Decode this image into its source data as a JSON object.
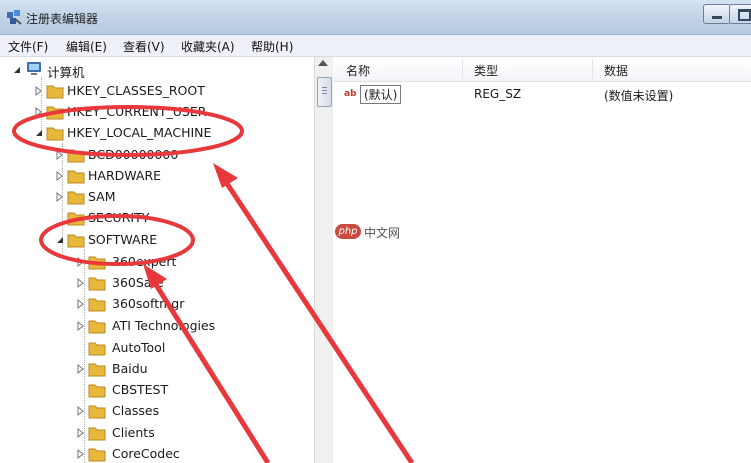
{
  "window": {
    "title": "注册表编辑器"
  },
  "menu": [
    {
      "label": "文件(F)"
    },
    {
      "label": "编辑(E)"
    },
    {
      "label": "查看(V)"
    },
    {
      "label": "收藏夹(A)"
    },
    {
      "label": "帮助(H)"
    }
  ],
  "tree": {
    "root": "计算机",
    "hives": [
      {
        "label": "HKEY_CLASSES_ROOT"
      },
      {
        "label": "HKEY_CURRENT_USER"
      },
      {
        "label": "HKEY_LOCAL_MACHINE"
      }
    ],
    "hklm_children": [
      {
        "label": "BCD00000000"
      },
      {
        "label": "HARDWARE"
      },
      {
        "label": "SAM"
      },
      {
        "label": "SECURITY"
      },
      {
        "label": "SOFTWARE"
      }
    ],
    "software_children": [
      {
        "label": "360expert"
      },
      {
        "label": "360Safe"
      },
      {
        "label": "360softmgr"
      },
      {
        "label": "ATI Technologies"
      },
      {
        "label": "AutoTool"
      },
      {
        "label": "Baidu"
      },
      {
        "label": "CBSTEST"
      },
      {
        "label": "Classes"
      },
      {
        "label": "Clients"
      },
      {
        "label": "CoreCodec"
      }
    ]
  },
  "list": {
    "columns": [
      "名称",
      "类型",
      "数据"
    ],
    "rows": [
      {
        "icon": "ab",
        "name": "(默认)",
        "type": "REG_SZ",
        "data": "(数值未设置)"
      }
    ]
  },
  "watermark": {
    "logo_text": "php",
    "text": "中文网"
  },
  "colors": {
    "annotation": "#e8383b",
    "folder": "#e8b83a"
  }
}
